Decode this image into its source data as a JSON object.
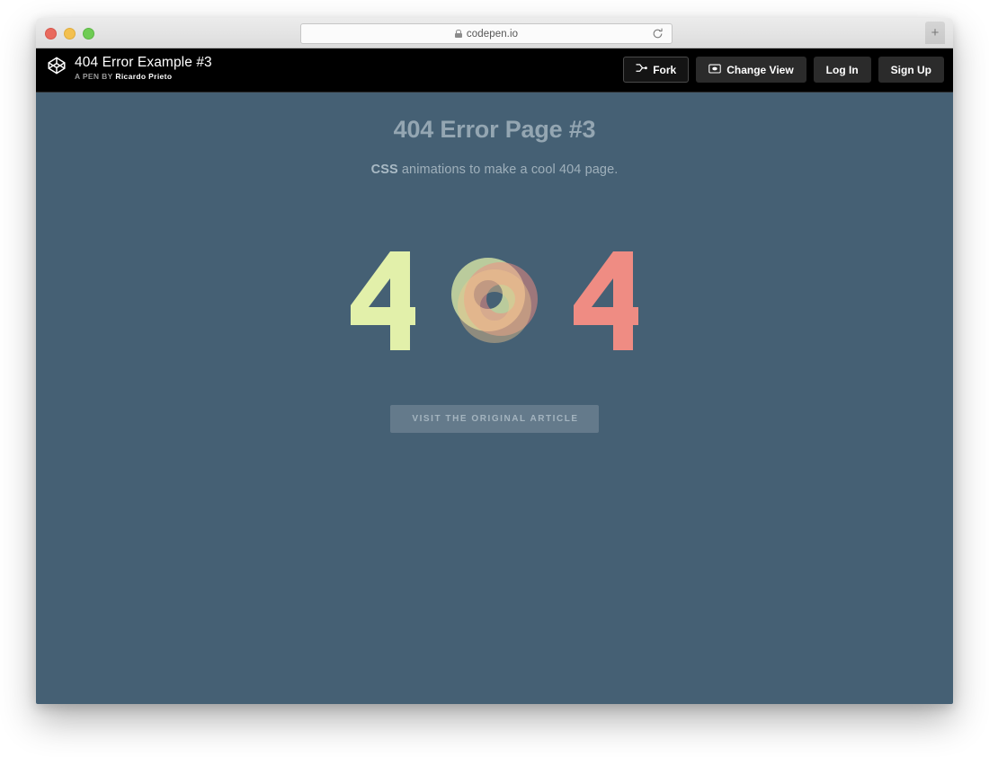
{
  "browser": {
    "url": "codepen.io",
    "lock_icon": "lock-icon",
    "reload_icon": "reload-icon",
    "new_tab_label": "+",
    "traffic_lights": [
      "close",
      "minimize",
      "zoom"
    ]
  },
  "pen_header": {
    "logo_icon": "codepen-logo-icon",
    "title": "404 Error Example #3",
    "byline_label": "A PEN BY",
    "byline_author": "Ricardo Prieto",
    "actions": [
      {
        "label": "Fork",
        "icon": "fork-icon",
        "style": "outlined"
      },
      {
        "label": "Change View",
        "icon": "change-view-icon",
        "style": "solid"
      },
      {
        "label": "Log In",
        "icon": "",
        "style": "solid"
      },
      {
        "label": "Sign Up",
        "icon": "",
        "style": "solid"
      }
    ]
  },
  "pen_content": {
    "headline": "404 Error Page #3",
    "subtitle_emphasis": "CSS",
    "subtitle_rest": " animations to make a cool 404 page.",
    "error_code": {
      "first_digit": "4",
      "middle_digit": "0",
      "last_digit": "4"
    },
    "cta_label": "Visit the original article",
    "colors": {
      "background": "#456074",
      "headline": "#94a6b2",
      "subtitle": "#9fb0bb",
      "digit_left": "#e2f0aa",
      "digit_right": "#ef8c83",
      "ring_yellow": "#e2f0aa",
      "ring_salmon": "#ef8c83",
      "cta_text": "#a4b4bf"
    }
  }
}
